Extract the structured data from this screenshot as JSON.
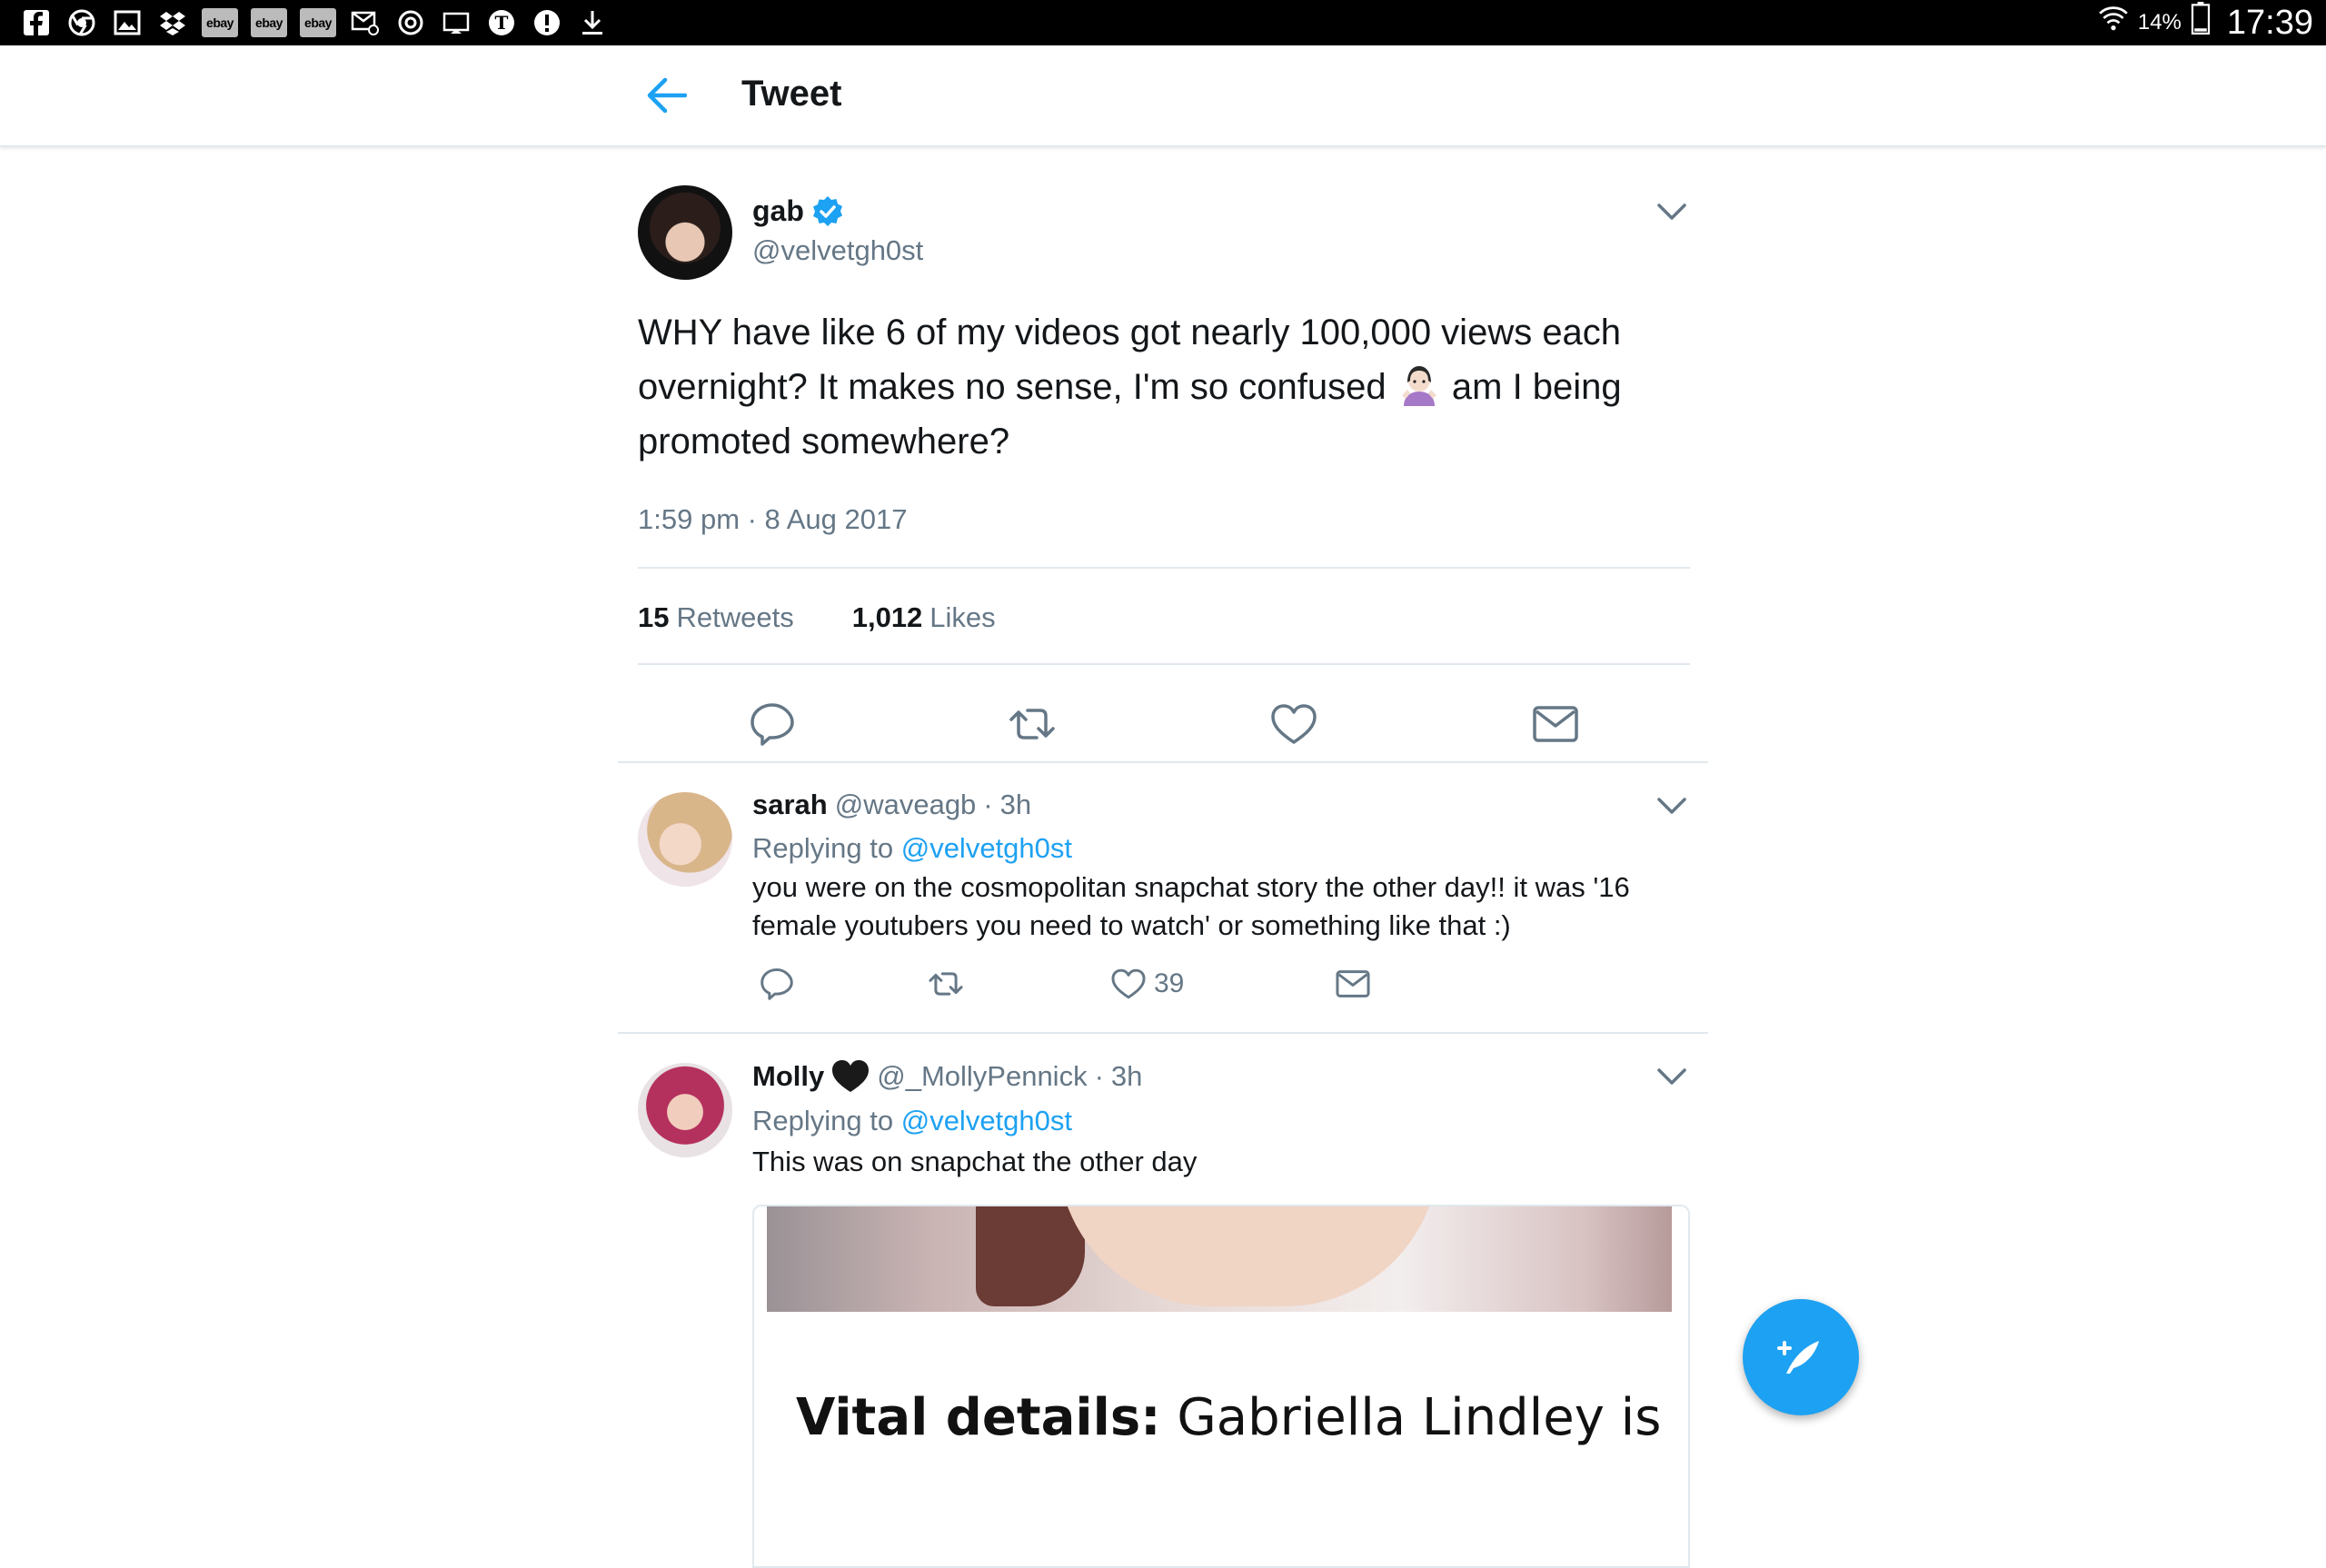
{
  "status_bar": {
    "ebay_labels": [
      "ebay",
      "ebay",
      "ebay"
    ],
    "battery": "14%",
    "time": "17:39"
  },
  "header": {
    "title": "Tweet"
  },
  "tweet": {
    "name": "gab",
    "handle": "@velvetgh0st",
    "text_part1": "WHY have like 6 of my videos got nearly 100,000 views each overnight? It makes no sense, I'm so confused",
    "text_part2": "am I being promoted somewhere?",
    "timestamp": "1:59 pm · 8 Aug 2017",
    "retweets_count": "15",
    "retweets_label": "Retweets",
    "likes_count": "1,012",
    "likes_label": "Likes"
  },
  "replies": [
    {
      "name": "sarah",
      "handle": "@waveagb",
      "separator": "·",
      "time": "3h",
      "replying_prefix": "Replying to",
      "replying_to": "@velvetgh0st",
      "text": "you were on the cosmopolitan snapchat story the other day!! it was '16 female youtubers you need to watch' or something like that :)",
      "likes": "39"
    },
    {
      "name": "Molly",
      "handle": "@_MollyPennick",
      "separator": "·",
      "time": "3h",
      "replying_prefix": "Replying to",
      "replying_to": "@velvetgh0st",
      "text": "This was on snapchat the other day",
      "media_caption_bold": "Vital details:",
      "media_caption_rest": "Gabriella Lindley is"
    }
  ],
  "colors": {
    "accent": "#1da1f2",
    "secondary_text": "#657786",
    "divider": "#e1e8ed"
  }
}
